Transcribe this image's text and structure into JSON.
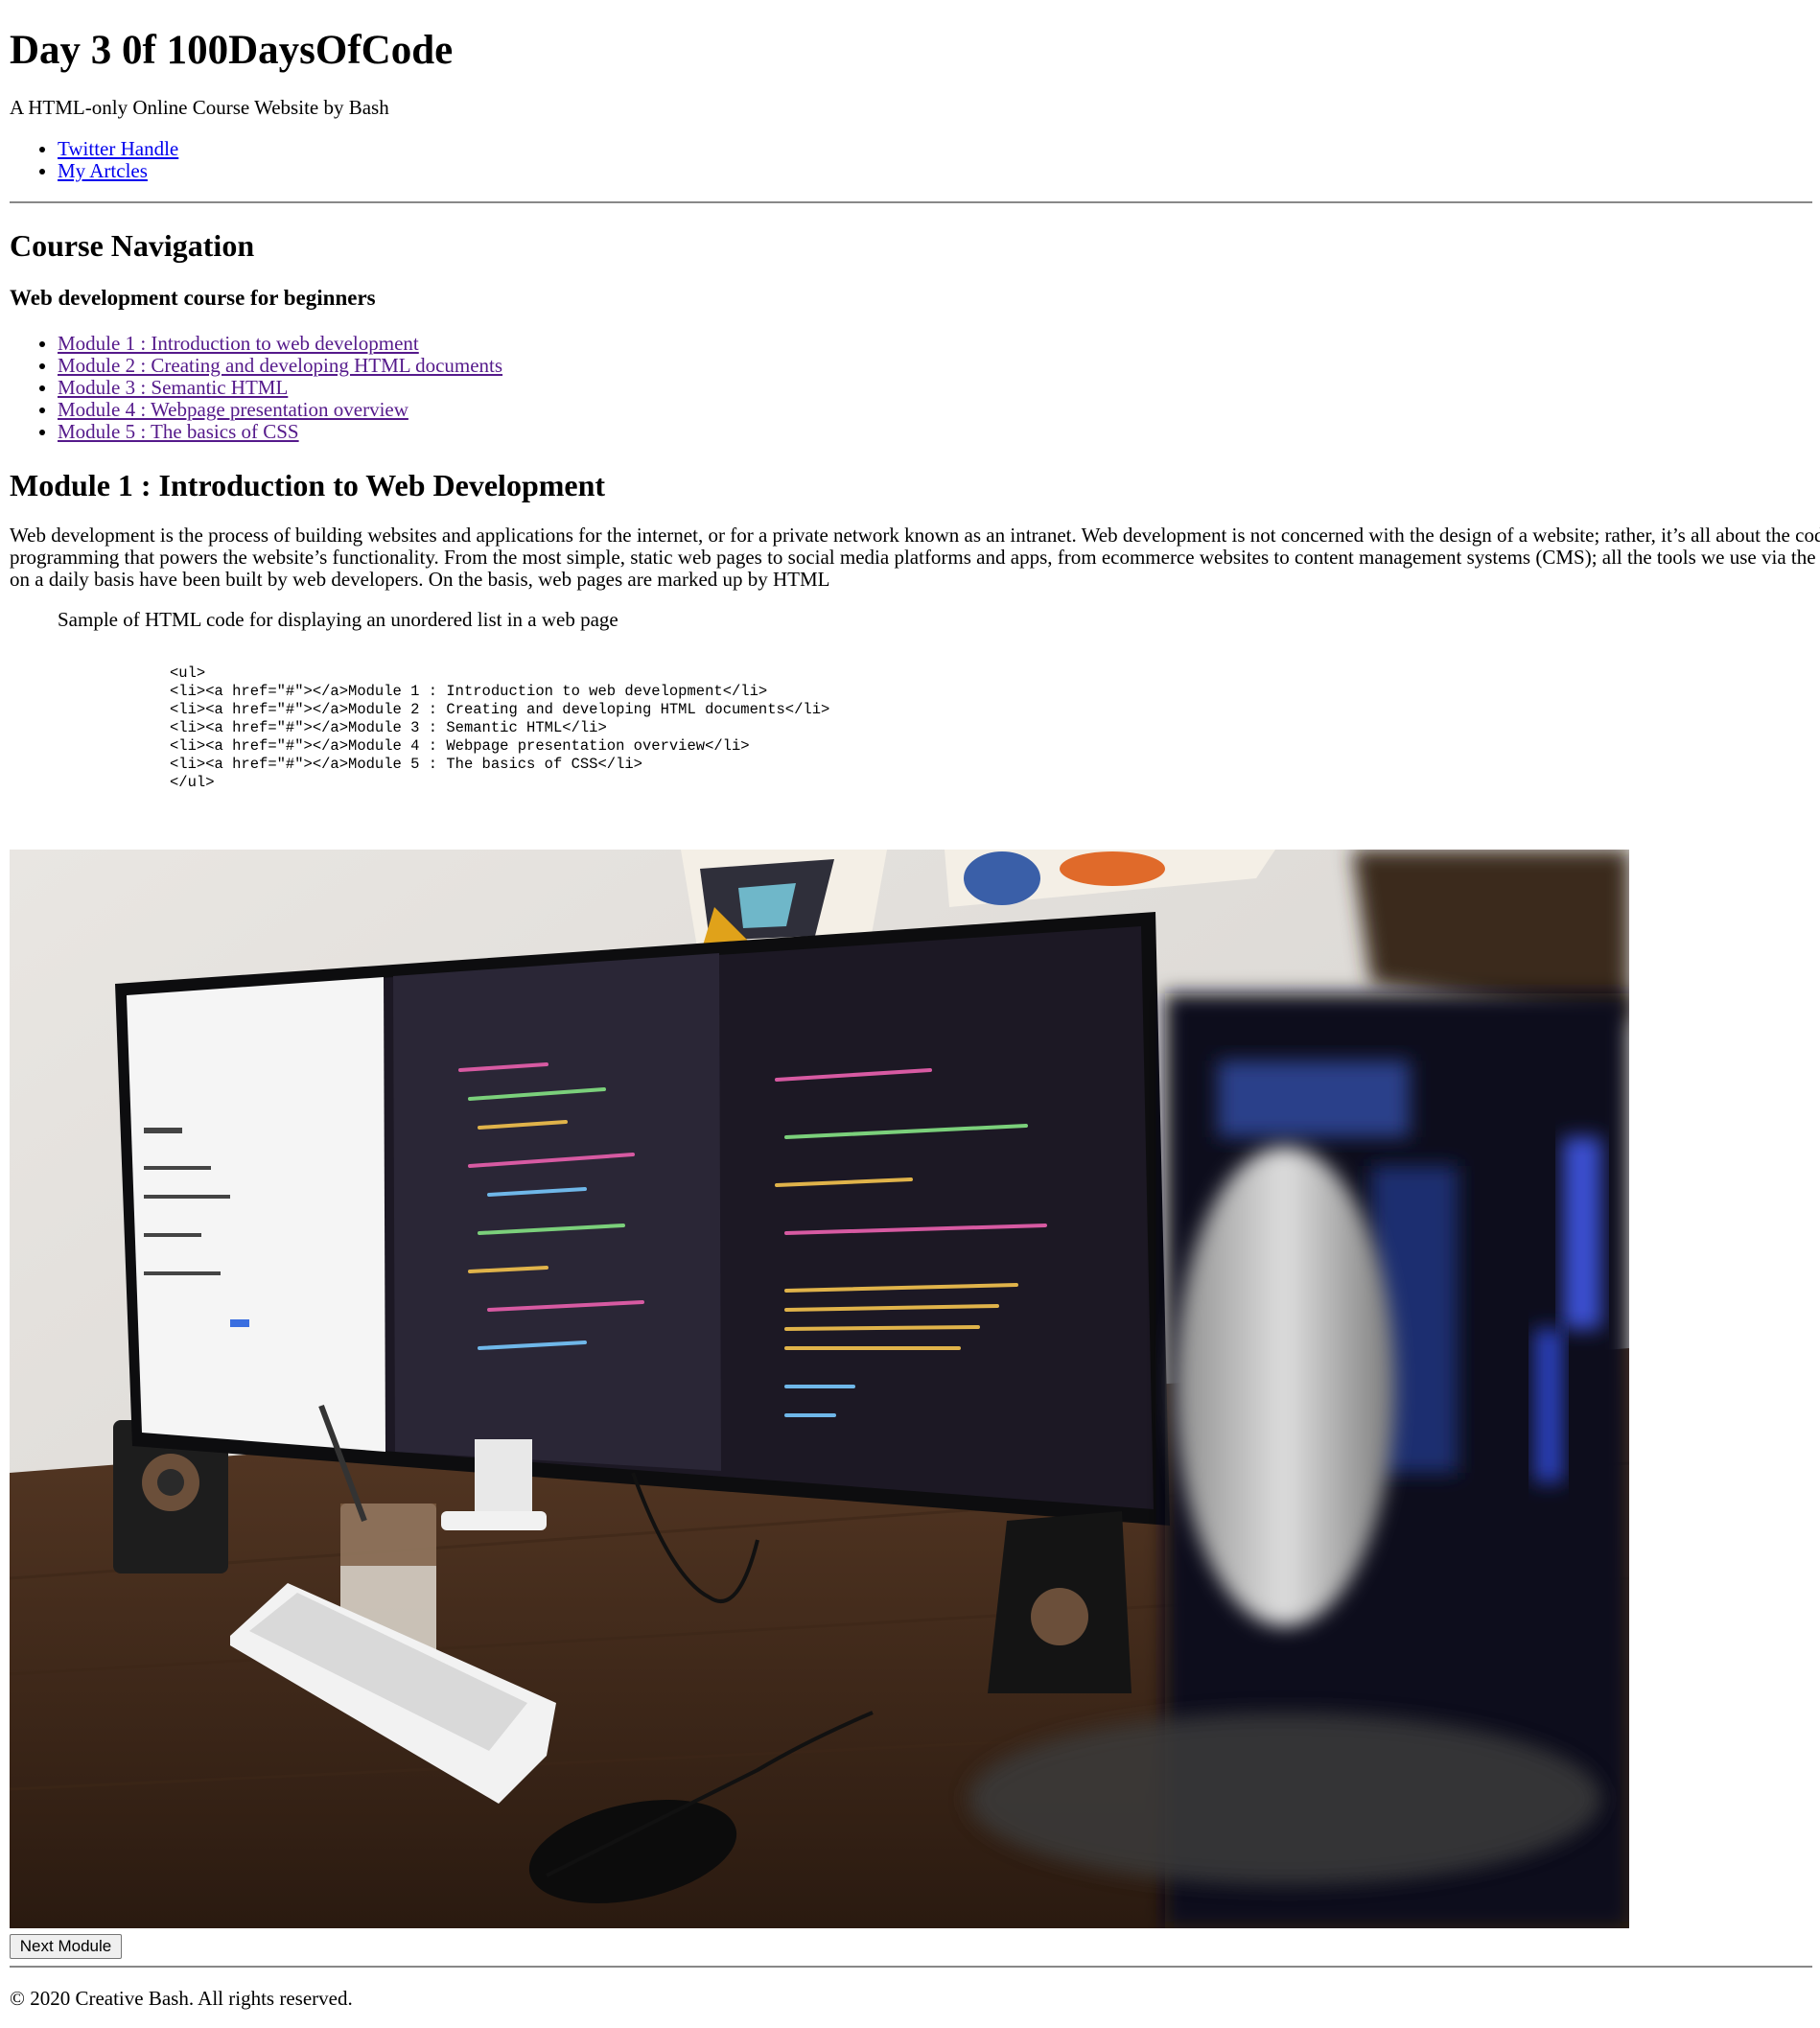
{
  "header": {
    "title": "Day 3 0f 100DaysOfCode",
    "subtitle": "A HTML-only Online Course Website by Bash",
    "links": [
      "Twitter Handle",
      "My Artcles"
    ]
  },
  "course_nav": {
    "heading": "Course Navigation",
    "subheading": "Web development course for beginners",
    "modules": [
      "Module 1 : Introduction to web development",
      "Module 2 : Creating and developing HTML documents",
      "Module 3 : Semantic HTML",
      "Module 4 : Webpage presentation overview",
      "Module 5 : The basics of CSS"
    ]
  },
  "module": {
    "heading": "Module 1 : Introduction to Web Development",
    "paragraph_lines": [
      "Web development is the process of building websites and applications for the internet, or for a private network known as an intranet. Web development is not concerned with the design of a website; rather, it’s all about the coding and",
      "programming that powers the website’s functionality. From the most simple, static web pages to social media platforms and apps, from ecommerce websites to content management systems (CMS); all the tools we use via the internet",
      "on a daily basis have been built by web developers. On the basis, web pages are marked up by HTML"
    ],
    "sample_caption": "Sample of HTML code for displaying an unordered list in a web page",
    "code_lines": [
      "<ul>",
      "<li><a href=\"#\"></a>Module 1 : Introduction to web development</li>",
      "<li><a href=\"#\"></a>Module 2 : Creating and developing HTML documents</li>",
      "<li><a href=\"#\"></a>Module 3 : Semantic HTML</li>",
      "<li><a href=\"#\"></a>Module 4 : Webpage presentation overview</li>",
      "<li><a href=\"#\"></a>Module 5 : The basics of CSS</li>",
      "</ul>"
    ]
  },
  "actions": {
    "next_label": "Next Module"
  },
  "footer": {
    "copyright": "© 2020 Creative Bash. All rights reserved."
  },
  "colors": {
    "link": "#0000ee",
    "visited_link": "#551a8b",
    "rule": "#888888"
  }
}
